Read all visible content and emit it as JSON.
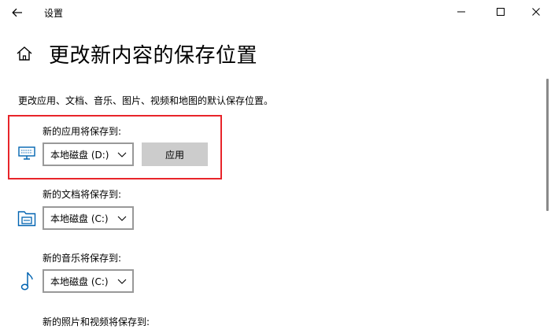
{
  "window": {
    "title": "设置"
  },
  "page": {
    "title": "更改新内容的保存位置",
    "description": "更改应用、文档、音乐、图片、视频和地图的默认保存位置。"
  },
  "sections": [
    {
      "label": "新的应用将保存到:",
      "icon": "monitor-icon",
      "drive": "本地磁盘 (D:)",
      "apply_label": "应用"
    },
    {
      "label": "新的文档将保存到:",
      "icon": "drive-folder-icon",
      "drive": "本地磁盘 (C:)"
    },
    {
      "label": "新的音乐将保存到:",
      "icon": "music-note-icon",
      "drive": "本地磁盘 (C:)"
    },
    {
      "label": "新的照片和视频将保存到:"
    }
  ],
  "colors": {
    "accent": "#0063b1",
    "highlight_border": "#e8242a",
    "apply_button_bg": "#cccccc",
    "select_border": "#999999"
  }
}
